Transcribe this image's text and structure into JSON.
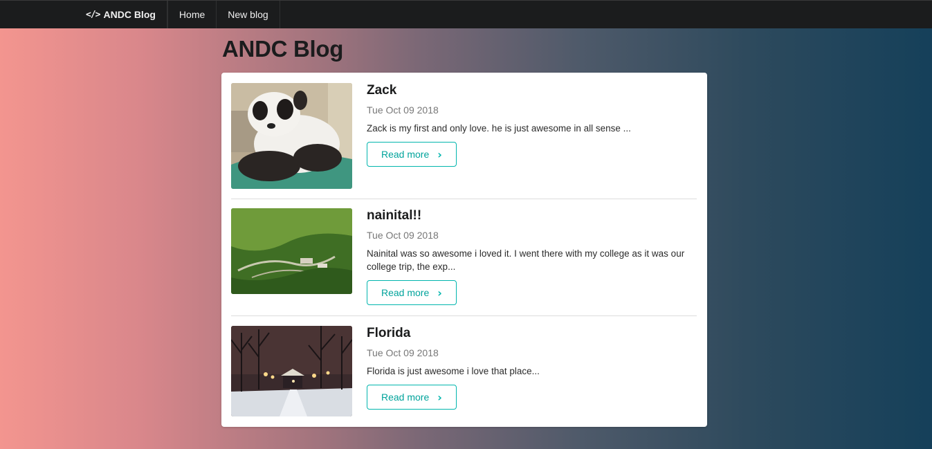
{
  "nav": {
    "brand_icon": "</>",
    "brand": "ANDC Blog",
    "home": "Home",
    "new_blog": "New blog"
  },
  "page": {
    "title": "ANDC Blog"
  },
  "posts": [
    {
      "title": "Zack",
      "date": "Tue Oct 09 2018",
      "excerpt": "Zack is my first and only love. he is just awesome in all sense ...",
      "read_more": "Read more",
      "image": "panda-dog-photo"
    },
    {
      "title": "nainital!!",
      "date": "Tue Oct 09 2018",
      "excerpt": "Nainital was so awesome i loved it. I went there with my college as it was our college trip, the exp...",
      "read_more": "Read more",
      "image": "green-valley-photo"
    },
    {
      "title": "Florida",
      "date": "Tue Oct 09 2018",
      "excerpt": "Florida is just awesome i love that place...",
      "read_more": "Read more",
      "image": "snowy-park-night-photo"
    }
  ],
  "icons": {
    "chevron": "chevron-right-icon",
    "brand": "code-icon"
  },
  "colors": {
    "accent": "#00b5ad",
    "topbar": "#1b1c1d"
  }
}
